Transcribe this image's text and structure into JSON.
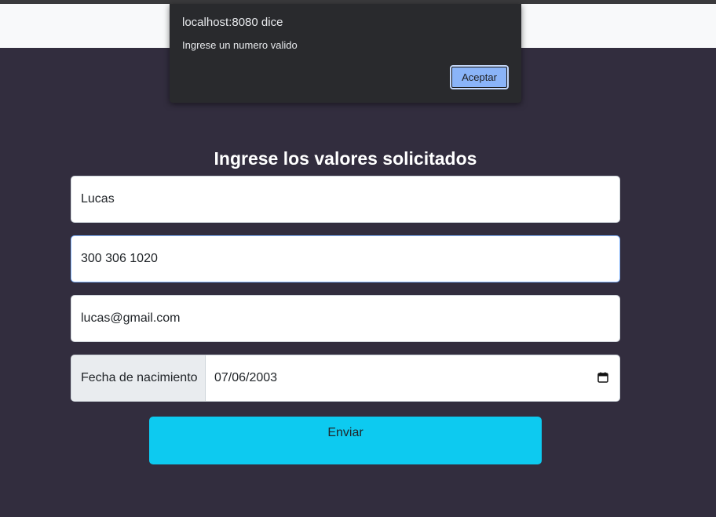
{
  "dialog": {
    "origin": "localhost:8080 dice",
    "message": "Ingrese un numero valido",
    "ok_label": "Aceptar"
  },
  "form": {
    "title": "Ingrese los valores solicitados",
    "name_value": "Lucas",
    "phone_value": "300 306 1020",
    "email_value": "lucas@gmail.com",
    "birthdate_label": "Fecha de nacimiento",
    "birthdate_value": "07/06/2003",
    "submit_label": "Enviar"
  },
  "colors": {
    "page_background": "#322d3e",
    "navbar_background": "#f8f9fa",
    "submit_button": "#0dcaf0",
    "dialog_background": "#292a2d",
    "dialog_button": "#8ab4f8"
  }
}
